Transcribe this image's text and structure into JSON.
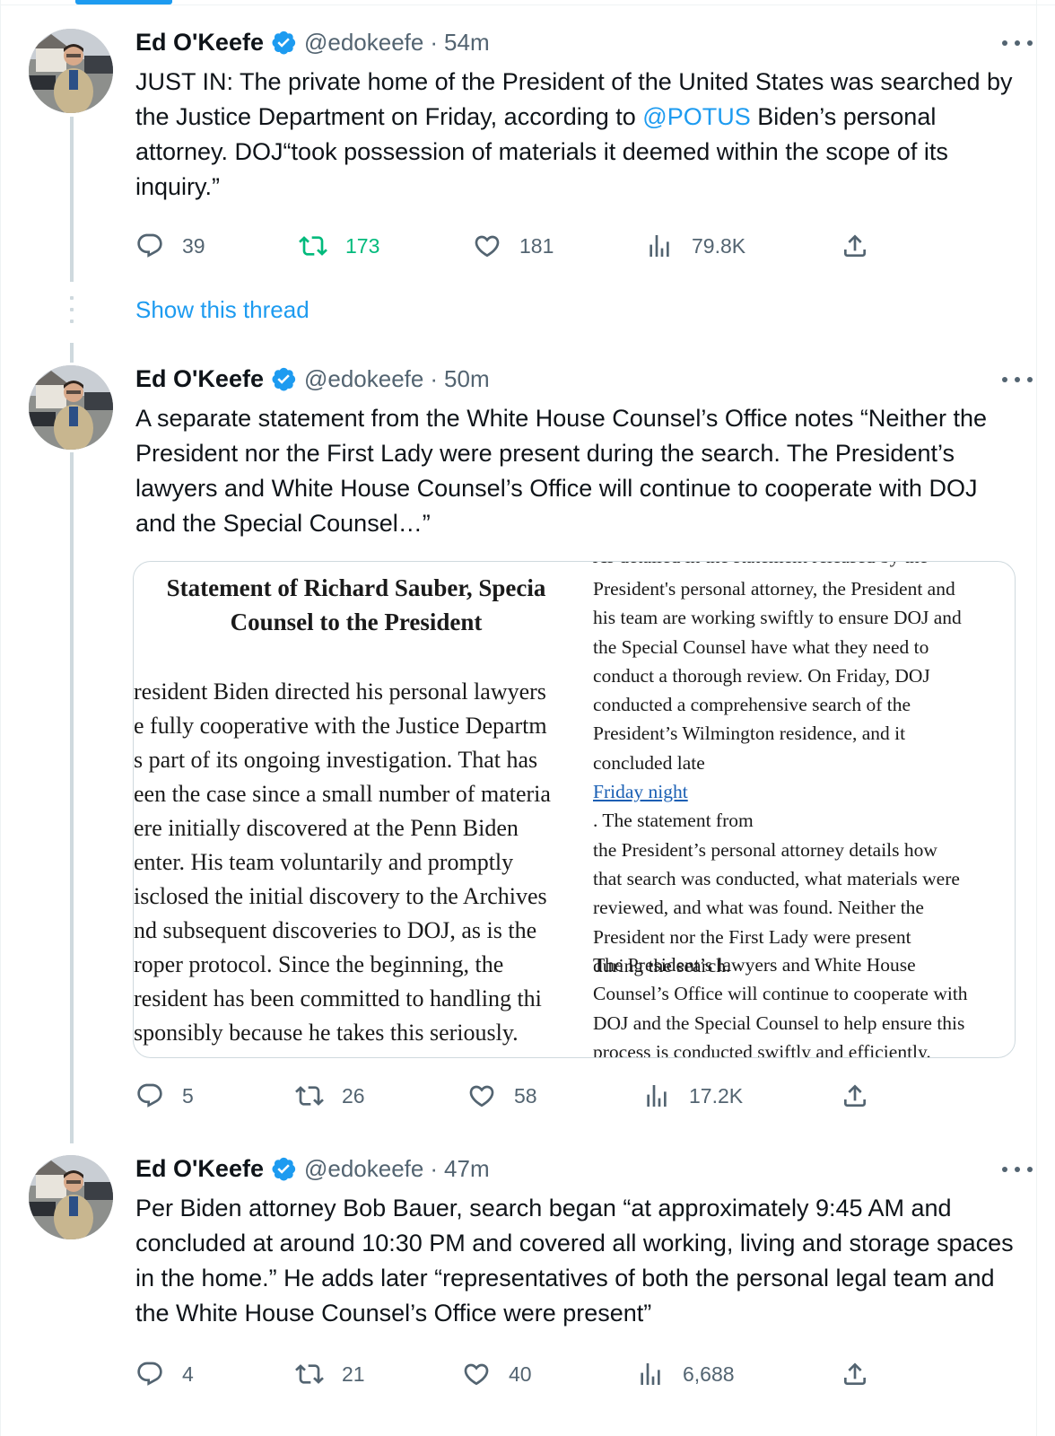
{
  "author": {
    "name": "Ed O'Keefe",
    "handle": "@edokeefe"
  },
  "tweets": [
    {
      "time": "54m",
      "text_before": "JUST IN: The private home of the President of the United States was searched by the Justice Department on Friday, according to ",
      "mention": "@POTUS",
      "text_after": " Biden’s personal attorney. DOJ“took possession of materials it deemed within the scope of its inquiry.”",
      "replies": "39",
      "retweets": "173",
      "likes": "181",
      "views": "79.8K"
    },
    {
      "time": "50m",
      "text": "A separate statement from the White House Counsel’s Office notes “Neither the President nor the First Lady were present during the search. The President’s lawyers and White House Counsel’s Office will continue to cooperate with DOJ and the Special Counsel…”",
      "replies": "5",
      "retweets": "26",
      "likes": "58",
      "views": "17.2K"
    },
    {
      "time": "47m",
      "text": "Per Biden attorney Bob Bauer, search began “at approximately 9:45 AM and concluded at around 10:30 PM and covered all working, living and storage spaces in the home.” He adds later “representatives of both the personal legal team and the White House Counsel’s Office were present”",
      "replies": "4",
      "retweets": "21",
      "likes": "40",
      "views": "6,688"
    }
  ],
  "show_thread": "Show this thread",
  "document": {
    "title_line1": "Statement of Richard Sauber, Specia",
    "title_line2": "Counsel to the President",
    "left_lines": [
      "resident Biden directed his personal lawyers",
      "e fully cooperative with the Justice Departm",
      "s part of its ongoing investigation. That has",
      "een the case since a small number of materia",
      "ere initially discovered at the Penn Biden",
      "enter. His team voluntarily and promptly",
      "isclosed the initial discovery to the Archives",
      "nd subsequent discoveries to DOJ, as is the",
      "roper protocol. Since the beginning, the",
      "resident has been committed to handling thi",
      "sponsibly because he takes this seriously."
    ],
    "right_top_cut": "As detailed in the statement released by the",
    "right_lines_1": [
      "President's personal attorney, the President and",
      "his team are working swiftly to ensure DOJ and",
      "the Special Counsel have what they need to",
      "conduct a thorough review. On Friday, DOJ",
      "conducted a comprehensive search of the",
      "President’s Wilmington residence, and it"
    ],
    "right_link_prefix": "concluded late ",
    "right_link": "Friday night",
    "right_link_suffix": ". The statement from",
    "right_lines_2": [
      "the President’s personal attorney details how",
      "that search was conducted, what materials were",
      "reviewed, and what was found. Neither the",
      "President nor the First Lady were present",
      "during the search."
    ],
    "right_lines_3": [
      "The President’s lawyers and White House",
      "Counsel’s Office will continue to cooperate with",
      "DOJ and the Special Counsel to help ensure this",
      "process is conducted swiftly and efficiently."
    ]
  },
  "colors": {
    "accent": "#1d9bf0",
    "retweet_active": "#00ba7c",
    "muted": "#536471"
  }
}
